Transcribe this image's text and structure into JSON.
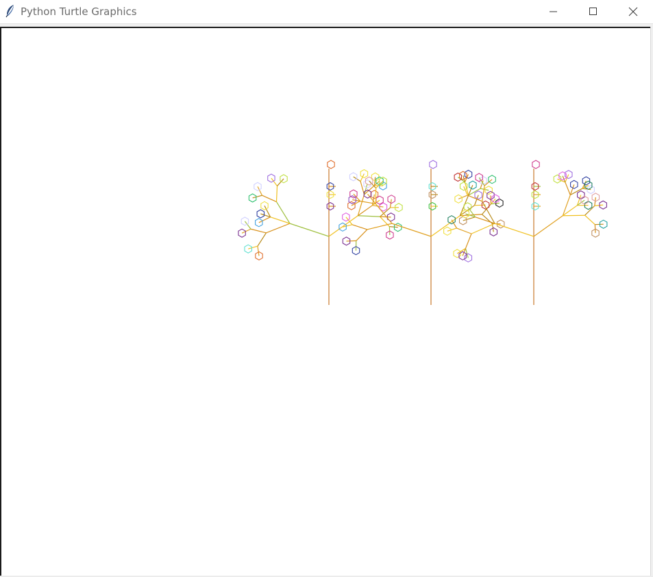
{
  "window": {
    "title": "Python Turtle Graphics",
    "icon": "feather-icon",
    "controls": {
      "minimize": "minimize-icon",
      "maximize": "maximize-icon",
      "close": "close-icon"
    }
  },
  "canvas": {
    "background": "#ffffff",
    "trunk_color": "#c8782a",
    "branch_colors": [
      "#e0a020",
      "#f0c020",
      "#d89018",
      "#b88a18",
      "#a0c040"
    ],
    "flower_colors": [
      "#d04090",
      "#7a3090",
      "#3040a0",
      "#a070e0",
      "#40a0e0",
      "#30c070",
      "#208060",
      "#c0e040",
      "#f0e040",
      "#e07030",
      "#c03030",
      "#202020",
      "#e0a0a0",
      "#60e0d0",
      "#9050c0",
      "#e060e0",
      "#40c040",
      "#c09060",
      "#20a0a0",
      "#d0d0ff"
    ]
  }
}
